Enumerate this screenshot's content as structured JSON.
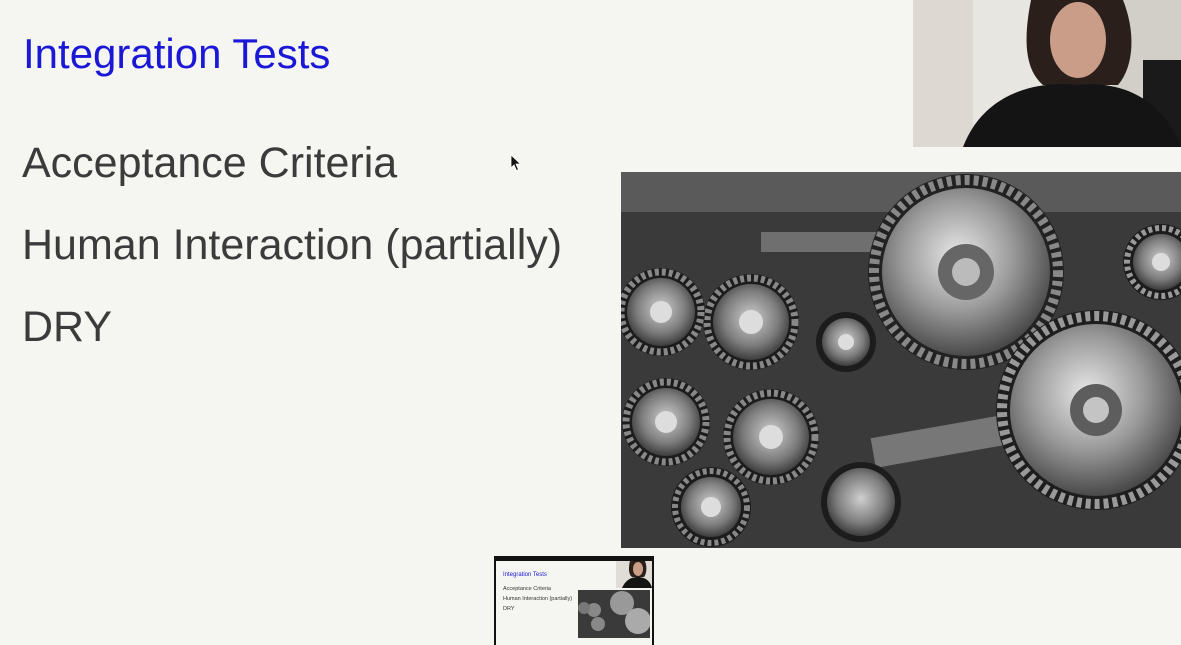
{
  "slide": {
    "title": "Integration Tests",
    "bullets": [
      "Acceptance Criteria",
      "Human Interaction (partially)",
      "DRY"
    ]
  },
  "images": {
    "main": "gears-photo",
    "webcam": "presenter-webcam"
  },
  "thumbnail": {
    "title": "Integration Tests",
    "bullets": [
      "Acceptance Criteria",
      "Human Interaction (partially)",
      "DRY"
    ]
  },
  "colors": {
    "background": "#f5f5f1",
    "title": "#1a17d6",
    "body_text": "#3b3b3b"
  }
}
